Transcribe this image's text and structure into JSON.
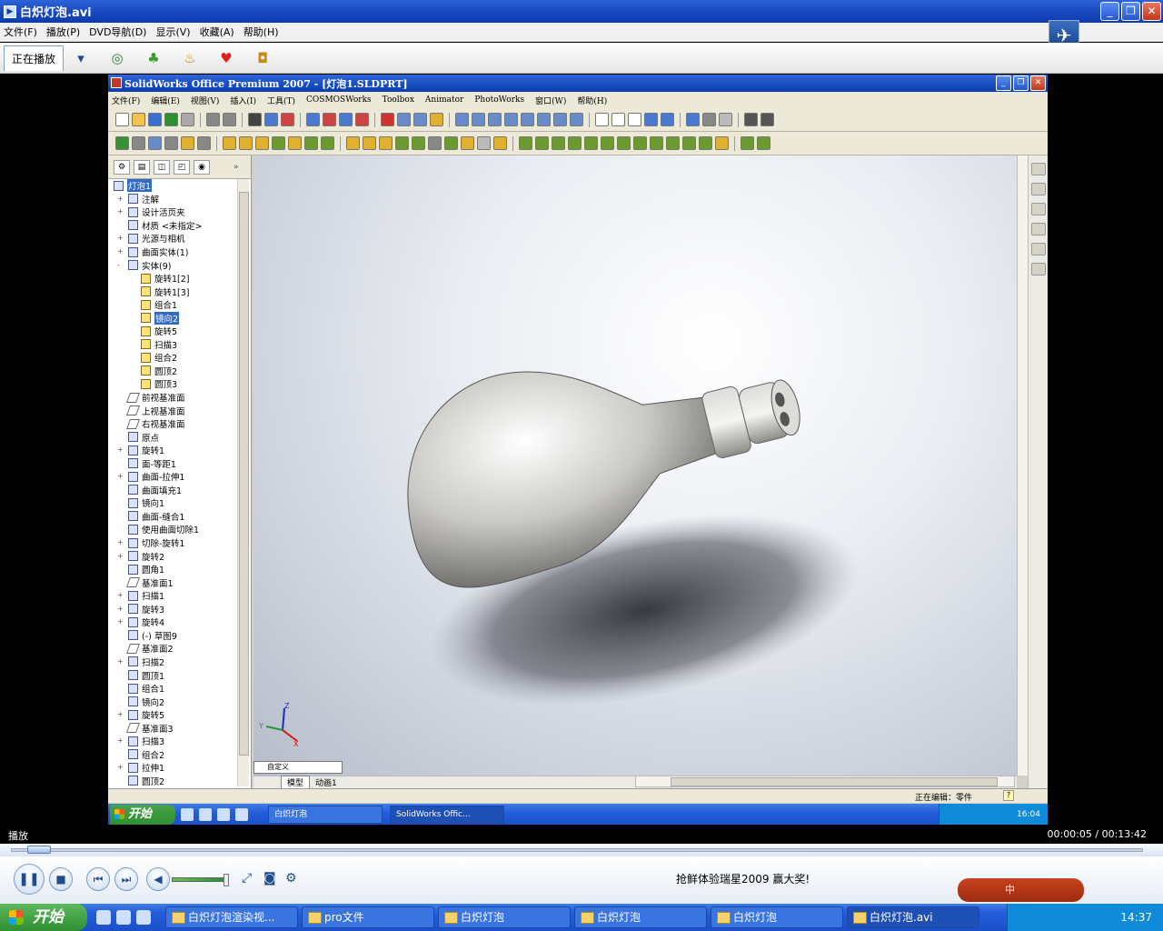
{
  "player": {
    "title": "白炽灯泡.avi",
    "menu": [
      "文件(F)",
      "播放(P)",
      "DVD导航(D)",
      "显示(V)",
      "收藏(A)",
      "帮助(H)"
    ],
    "tab_now": "正在播放",
    "status_left": "播放",
    "time": "00:00:05 / 00:13:42",
    "ad_text": "抢鲜体验瑞星2009 赢大奖!",
    "ime_text": "中"
  },
  "sw": {
    "title": "SolidWorks Office Premium 2007 - [灯泡1.SLDPRT]",
    "menu": [
      "文件(F)",
      "编辑(E)",
      "视图(V)",
      "插入(I)",
      "工具(T)",
      "COSMOSWorks",
      "Toolbox",
      "Animator",
      "PhotoWorks",
      "窗口(W)",
      "帮助(H)"
    ],
    "tree_root": "灯泡1",
    "tree": [
      {
        "label": "注解",
        "exp": "+",
        "indent": 0,
        "icon": "feat"
      },
      {
        "label": "设计活页夹",
        "exp": "+",
        "indent": 0,
        "icon": "feat"
      },
      {
        "label": "材质 <未指定>",
        "exp": "",
        "indent": 0,
        "icon": "feat"
      },
      {
        "label": "光源与相机",
        "exp": "+",
        "indent": 0,
        "icon": "feat"
      },
      {
        "label": "曲面实体(1)",
        "exp": "+",
        "indent": 0,
        "icon": "feat"
      },
      {
        "label": "实体(9)",
        "exp": "-",
        "indent": 0,
        "icon": "feat"
      },
      {
        "label": "旋转1[2]",
        "exp": "",
        "indent": 1,
        "icon": "body"
      },
      {
        "label": "旋转1[3]",
        "exp": "",
        "indent": 1,
        "icon": "body"
      },
      {
        "label": "组合1",
        "exp": "",
        "indent": 1,
        "icon": "body"
      },
      {
        "label": "镜向2",
        "exp": "",
        "indent": 1,
        "icon": "body",
        "selected": true
      },
      {
        "label": "旋转5",
        "exp": "",
        "indent": 1,
        "icon": "body"
      },
      {
        "label": "扫描3",
        "exp": "",
        "indent": 1,
        "icon": "body"
      },
      {
        "label": "组合2",
        "exp": "",
        "indent": 1,
        "icon": "body"
      },
      {
        "label": "圆顶2",
        "exp": "",
        "indent": 1,
        "icon": "body"
      },
      {
        "label": "圆顶3",
        "exp": "",
        "indent": 1,
        "icon": "body"
      },
      {
        "label": "前视基准面",
        "exp": "",
        "indent": 0,
        "icon": "plane"
      },
      {
        "label": "上视基准面",
        "exp": "",
        "indent": 0,
        "icon": "plane"
      },
      {
        "label": "右视基准面",
        "exp": "",
        "indent": 0,
        "icon": "plane"
      },
      {
        "label": "原点",
        "exp": "",
        "indent": 0,
        "icon": "feat"
      },
      {
        "label": "旋转1",
        "exp": "+",
        "indent": 0,
        "icon": "feat"
      },
      {
        "label": "面-等距1",
        "exp": "",
        "indent": 0,
        "icon": "feat"
      },
      {
        "label": "曲面-拉伸1",
        "exp": "+",
        "indent": 0,
        "icon": "feat"
      },
      {
        "label": "曲面填充1",
        "exp": "",
        "indent": 0,
        "icon": "feat"
      },
      {
        "label": "镜向1",
        "exp": "",
        "indent": 0,
        "icon": "feat"
      },
      {
        "label": "曲面-缝合1",
        "exp": "",
        "indent": 0,
        "icon": "feat"
      },
      {
        "label": "使用曲面切除1",
        "exp": "",
        "indent": 0,
        "icon": "feat"
      },
      {
        "label": "切除-旋转1",
        "exp": "+",
        "indent": 0,
        "icon": "feat"
      },
      {
        "label": "旋转2",
        "exp": "+",
        "indent": 0,
        "icon": "feat"
      },
      {
        "label": "圆角1",
        "exp": "",
        "indent": 0,
        "icon": "feat"
      },
      {
        "label": "基准面1",
        "exp": "",
        "indent": 0,
        "icon": "plane"
      },
      {
        "label": "扫描1",
        "exp": "+",
        "indent": 0,
        "icon": "feat"
      },
      {
        "label": "旋转3",
        "exp": "+",
        "indent": 0,
        "icon": "feat"
      },
      {
        "label": "旋转4",
        "exp": "+",
        "indent": 0,
        "icon": "feat"
      },
      {
        "label": "(-) 草图9",
        "exp": "",
        "indent": 0,
        "icon": "feat"
      },
      {
        "label": "基准面2",
        "exp": "",
        "indent": 0,
        "icon": "plane"
      },
      {
        "label": "扫描2",
        "exp": "+",
        "indent": 0,
        "icon": "feat"
      },
      {
        "label": "圆顶1",
        "exp": "",
        "indent": 0,
        "icon": "feat"
      },
      {
        "label": "组合1",
        "exp": "",
        "indent": 0,
        "icon": "feat"
      },
      {
        "label": "镜向2",
        "exp": "",
        "indent": 0,
        "icon": "feat"
      },
      {
        "label": "旋转5",
        "exp": "+",
        "indent": 0,
        "icon": "feat"
      },
      {
        "label": "基准面3",
        "exp": "",
        "indent": 0,
        "icon": "plane"
      },
      {
        "label": "扫描3",
        "exp": "+",
        "indent": 0,
        "icon": "feat"
      },
      {
        "label": "组合2",
        "exp": "",
        "indent": 0,
        "icon": "feat"
      },
      {
        "label": "拉伸1",
        "exp": "+",
        "indent": 0,
        "icon": "feat"
      },
      {
        "label": "圆顶2",
        "exp": "",
        "indent": 0,
        "icon": "feat"
      }
    ],
    "combo_value": "自定义",
    "tab_model": "模型",
    "tab_anim": "动画1",
    "status": "正在编辑：零件",
    "axis_x": "X",
    "axis_y": "Y",
    "axis_z": "Z"
  },
  "inner_taskbar": {
    "start": "开始",
    "items": [
      "白炽灯泡",
      "SolidWorks Offic..."
    ],
    "clock": "16:04"
  },
  "taskbar": {
    "start": "开始",
    "items": [
      "白炽灯泡渲染视...",
      "pro文件",
      "白炽灯泡",
      "白炽灯泡",
      "白炽灯泡",
      "白炽灯泡.avi"
    ],
    "clock": "14:37"
  }
}
